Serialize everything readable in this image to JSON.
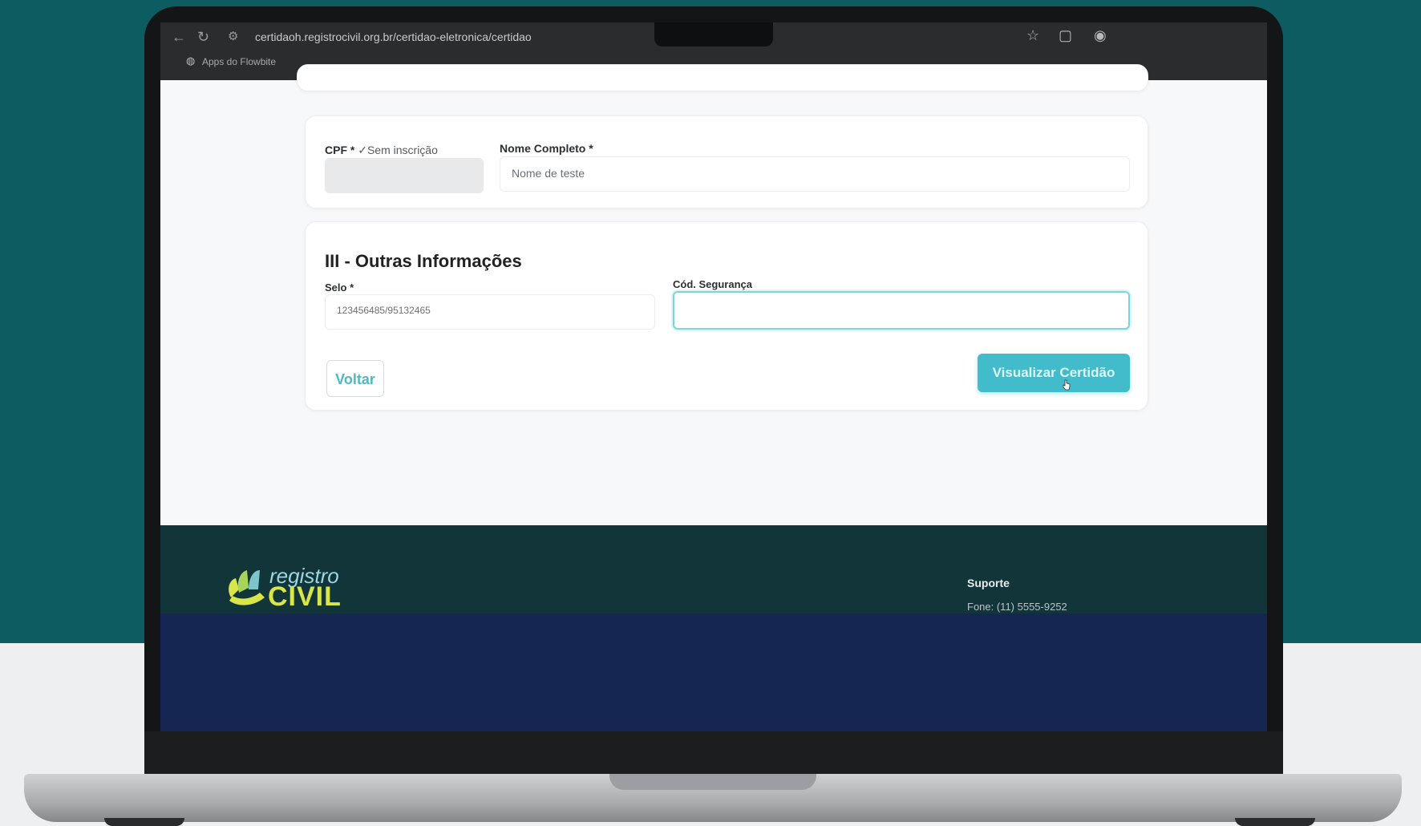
{
  "browser": {
    "url": "certidaoh.registrocivil.org.br/certidao-eletronica/certidao",
    "tab_label": "Apps do Flowbite",
    "nav_icons": [
      "back-arrow-icon",
      "reload-icon",
      "site-settings-icon"
    ],
    "right_icons": [
      "star-icon",
      "extensions-icon",
      "profile-icon"
    ]
  },
  "form_top": {
    "cpf_label": "CPF *",
    "cpf_note": "✓Sem inscrição",
    "cpf_value": "",
    "name_label": "Nome Completo *",
    "name_value": "Nome de teste"
  },
  "other_info": {
    "title": "III - Outras Informações",
    "selo_label": "Selo *",
    "selo_value": "123456485/95132465",
    "cod_label": "Cód. Segurança",
    "cod_value": ""
  },
  "actions": {
    "back_label": "Voltar",
    "view_label": "Visualizar Certidão"
  },
  "footer": {
    "logo_top": "registro",
    "logo_bottom": "CIVIL",
    "support_title": "Suporte",
    "support_phone": "Fone: (11) 5555-9252"
  },
  "colors": {
    "accent": "#42bccb",
    "footer_dark": "#12353a",
    "footer_navy": "#152652",
    "background_teal": "#0c5c62"
  }
}
